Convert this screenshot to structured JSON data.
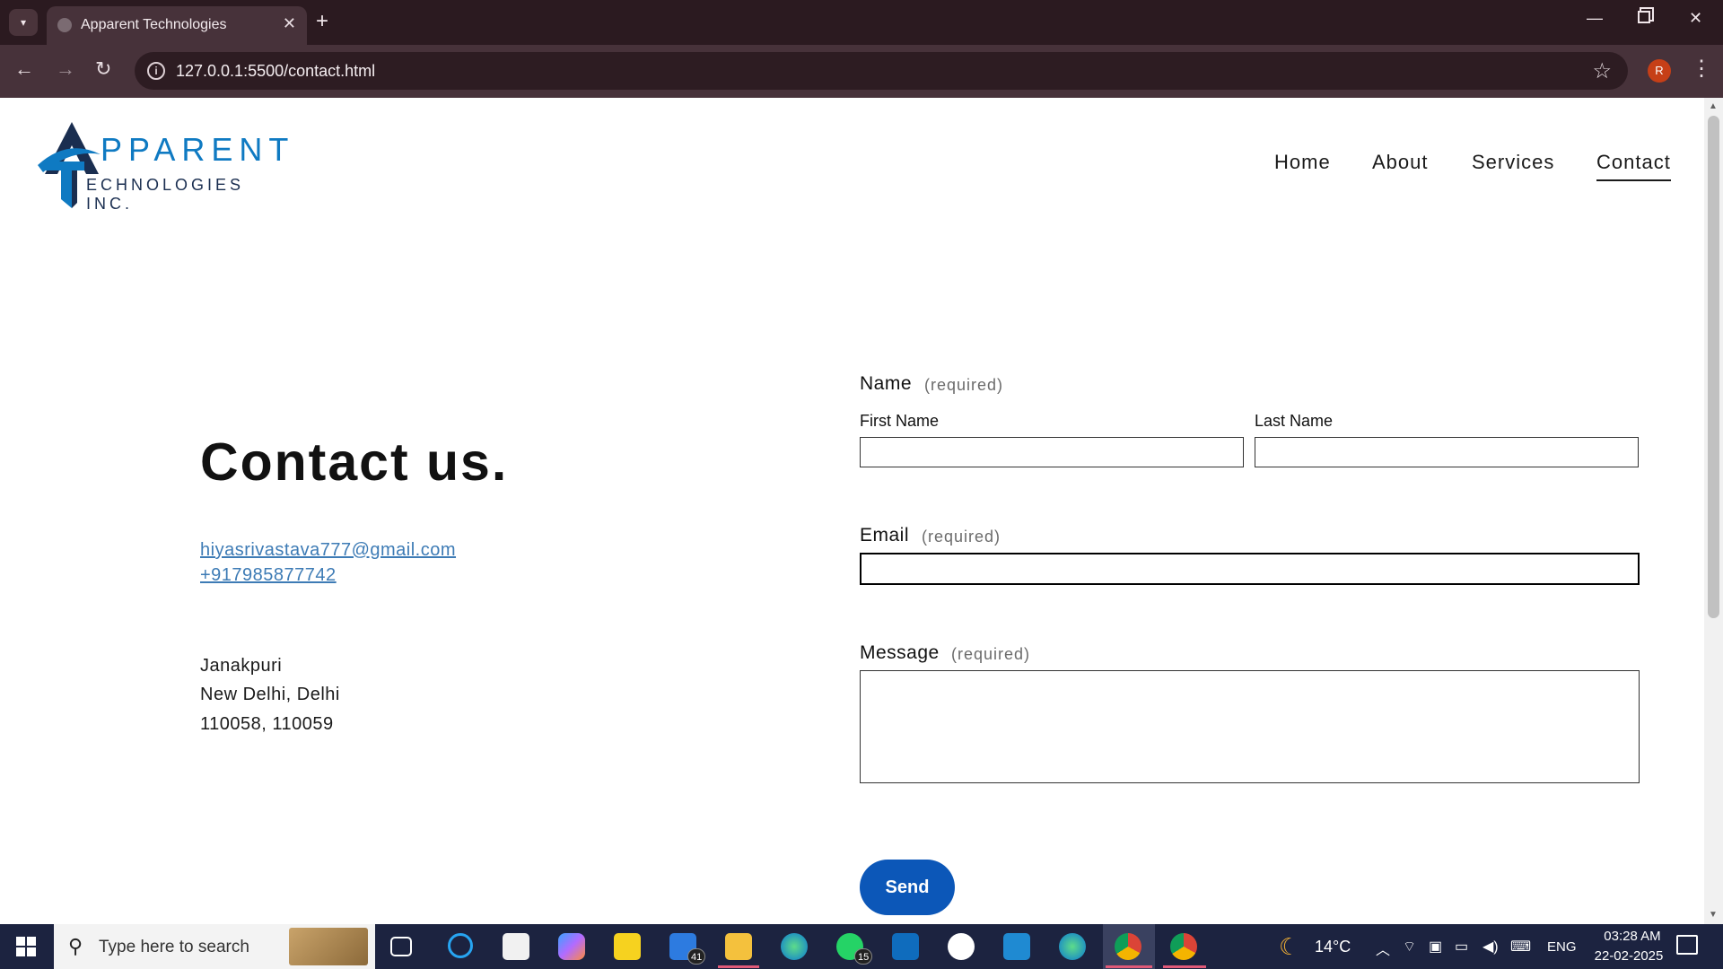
{
  "browser": {
    "tab_title": "Apparent Technologies",
    "url": "127.0.0.1:5500/contact.html",
    "profile_initial": "R"
  },
  "logo": {
    "line1": "PPARENT",
    "line2": "ECHNOLOGIES INC.",
    "brand_color": "#0f7ac2"
  },
  "nav": {
    "home": "Home",
    "about": "About",
    "services": "Services",
    "contact": "Contact"
  },
  "contact": {
    "title": "Contact us.",
    "email": "hiyasrivastava777@gmail.com",
    "phone": "+917985877742",
    "address_line1": "Janakpuri",
    "address_line2": "New Delhi, Delhi",
    "address_line3": "110058, 110059"
  },
  "form": {
    "name_label": "Name",
    "required": "(required)",
    "first_name_label": "First Name",
    "last_name_label": "Last Name",
    "email_label": "Email",
    "message_label": "Message",
    "first_name_value": "",
    "last_name_value": "",
    "email_value": "",
    "message_value": "",
    "send_label": "Send",
    "button_color": "#0c57b8"
  },
  "taskbar": {
    "search_placeholder": "Type here to search",
    "mail_badge": "41",
    "whatsapp_badge": "15",
    "temperature": "14°C",
    "language": "ENG",
    "time": "03:28 AM",
    "date": "22-02-2025"
  }
}
